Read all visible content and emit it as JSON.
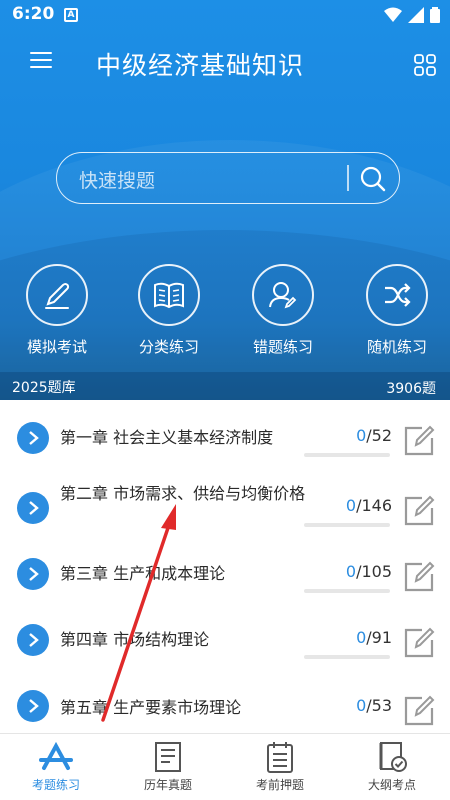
{
  "status": {
    "time": "6:20",
    "notif_letter": "A"
  },
  "app": {
    "title": "中级经济基础知识"
  },
  "search": {
    "placeholder": "快速搜题"
  },
  "features": [
    {
      "label": "模拟考试",
      "icon": "pen-icon"
    },
    {
      "label": "分类练习",
      "icon": "book-icon"
    },
    {
      "label": "错题练习",
      "icon": "user-edit-icon"
    },
    {
      "label": "随机练习",
      "icon": "shuffle-icon"
    }
  ],
  "bank": {
    "name": "2025题库",
    "count": "3906题"
  },
  "chapters": [
    {
      "title": "第一章 社会主义基本经济制度",
      "done": "0",
      "total": "/52"
    },
    {
      "title": "第二章 市场需求、供给与均衡价格",
      "done": "0",
      "total": "/146"
    },
    {
      "title": "第三章 生产和成本理论",
      "done": "0",
      "total": "/105"
    },
    {
      "title": "第四章 市场结构理论",
      "done": "0",
      "total": "/91"
    },
    {
      "title": "第五章 生产要素市场理论",
      "done": "0",
      "total": "/53"
    }
  ],
  "tabs": [
    {
      "label": "考题练习",
      "active": true
    },
    {
      "label": "历年真题",
      "active": false
    },
    {
      "label": "考前押题",
      "active": false
    },
    {
      "label": "大纲考点",
      "active": false
    }
  ],
  "colors": {
    "primary": "#1d8fe6",
    "accent": "#2c8de0",
    "annotation": "#e02a2a"
  }
}
